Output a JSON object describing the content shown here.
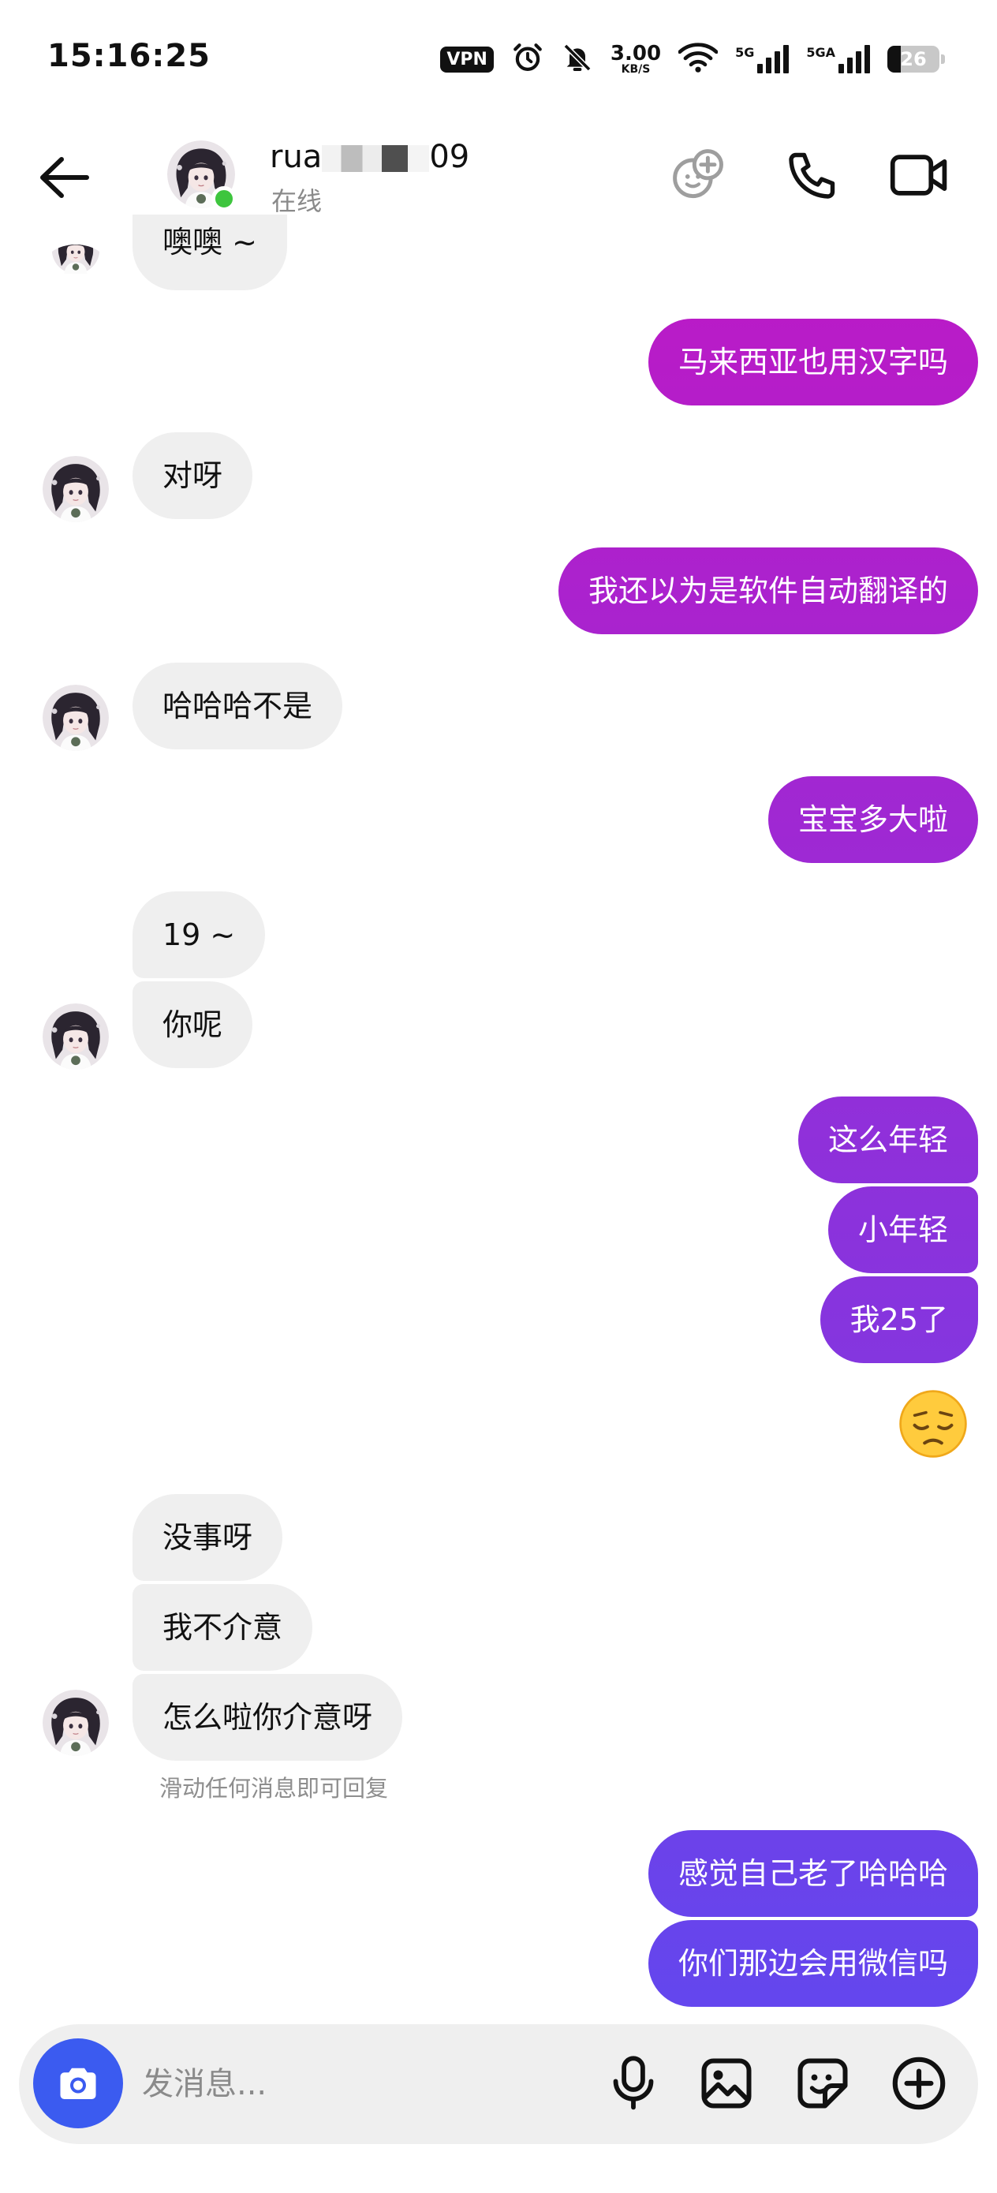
{
  "status_bar": {
    "time": "15:16:25",
    "vpn_label": "VPN",
    "net_speed_value": "3.00",
    "net_speed_unit": "KB/S",
    "sim1_label": "5G",
    "sim2_label": "5GA",
    "battery_level": "26"
  },
  "header": {
    "name_prefix": "rua",
    "name_suffix": "09",
    "status": "在线"
  },
  "messages": [
    {
      "side": "in",
      "text": "噢噢 ~"
    },
    {
      "side": "out",
      "text": "马来西亚也用汉字吗"
    },
    {
      "side": "in",
      "text": "对呀"
    },
    {
      "side": "out",
      "text": "我还以为是软件自动翻译的"
    },
    {
      "side": "in",
      "text": "哈哈哈不是"
    },
    {
      "side": "out",
      "text": "宝宝多大啦"
    },
    {
      "side": "in",
      "text": "19 ~"
    },
    {
      "side": "in",
      "text": "你呢"
    },
    {
      "side": "out",
      "text": "这么年轻"
    },
    {
      "side": "out",
      "text": "小年轻"
    },
    {
      "side": "out",
      "text": "我25了"
    },
    {
      "side": "out",
      "text": "😔"
    },
    {
      "side": "in",
      "text": "没事呀"
    },
    {
      "side": "in",
      "text": "我不介意"
    },
    {
      "side": "in",
      "text": "怎么啦你介意呀"
    },
    {
      "side": "out",
      "text": "感觉自己老了哈哈哈"
    },
    {
      "side": "out",
      "text": "你们那边会用微信吗"
    }
  ],
  "reply_hint": "滑动任何消息即可回复",
  "composer": {
    "placeholder": "发消息..."
  },
  "colors": {
    "incoming_bubble": "#efefef",
    "outgoing_gradient_top": "#c913c0",
    "outgoing_gradient_bottom": "#5a4bf2",
    "online": "#3ec53e",
    "camera_button": "#3b5bf0"
  },
  "icons": [
    "back-arrow-icon",
    "avatar",
    "add-people-icon",
    "phone-icon",
    "video-icon",
    "camera-icon",
    "microphone-icon",
    "image-icon",
    "sticker-icon",
    "plus-icon"
  ]
}
